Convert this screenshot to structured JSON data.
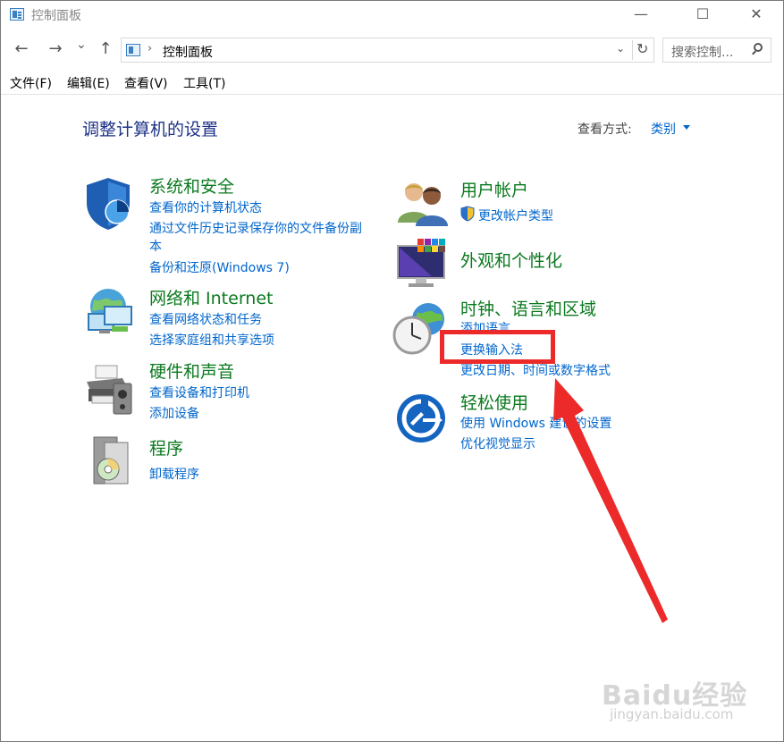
{
  "window": {
    "title": "控制面板",
    "minimize": "—",
    "maximize": "☐",
    "close": "✕"
  },
  "toolbar": {
    "back": "←",
    "forward": "→",
    "recent": "⌄",
    "up": "↑",
    "breadcrumb_separator": "›",
    "address": "控制面板",
    "address_dropdown": "⌄",
    "refresh": "↻",
    "search_placeholder": "搜索控制..."
  },
  "menu": {
    "items": [
      "文件(F)",
      "编辑(E)",
      "查看(V)",
      "工具(T)"
    ]
  },
  "content": {
    "heading": "调整计算机的设置",
    "view_by_label": "查看方式:",
    "view_by_value": "类别"
  },
  "categories": {
    "system_security": {
      "icon": "shield-icon",
      "title": "系统和安全",
      "links": [
        "查看你的计算机状态",
        "通过文件历史记录保存你的文件备份副",
        "本",
        "备份和还原(Windows 7)"
      ]
    },
    "network": {
      "icon": "network-icon",
      "title": "网络和 Internet",
      "links": [
        "查看网络状态和任务",
        "选择家庭组和共享选项"
      ]
    },
    "hardware": {
      "icon": "printer-icon",
      "title": "硬件和声音",
      "links": [
        "查看设备和打印机",
        "添加设备"
      ]
    },
    "programs": {
      "icon": "programs-icon",
      "title": "程序",
      "links": [
        "卸载程序"
      ]
    },
    "user_accounts": {
      "icon": "users-icon",
      "title": "用户帐户",
      "links": [
        "更改帐户类型"
      ]
    },
    "appearance": {
      "icon": "monitor-icon",
      "title": "外观和个性化",
      "links": []
    },
    "clock_region": {
      "icon": "clock-icon",
      "title": "时钟、语言和区域",
      "links": [
        "添加语言",
        "更换输入法",
        "更改日期、时间或数字格式"
      ]
    },
    "ease_access": {
      "icon": "ease-of-access-icon",
      "title": "轻松使用",
      "links": [
        "使用 Windows 建议的设置",
        "优化视觉显示"
      ]
    }
  },
  "watermark": {
    "main": "Baidu经验",
    "sub": "jingyan.baidu.com"
  },
  "colors": {
    "category_title": "#0b7a1f",
    "link": "#0066cc",
    "heading": "#1e3287",
    "annotation": "#ec2a2a"
  }
}
